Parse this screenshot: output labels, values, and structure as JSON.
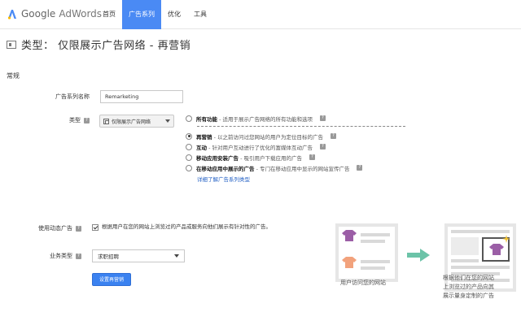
{
  "header": {
    "logo_google": "Google",
    "logo_adwords": "AdWords",
    "nav": [
      "首页",
      "广告系列",
      "优化",
      "工具"
    ],
    "active_nav": "广告系列"
  },
  "page": {
    "title": "类型： 仅限展示广告网络 - 再营销"
  },
  "section": {
    "general": "常规"
  },
  "form": {
    "name_label": "广告系列名称",
    "name_value": "Remarketing",
    "type_label": "类型",
    "type_value": "仅限展示广告网络",
    "dynamic_label": "使用动态广告",
    "dynamic_text": "根据用户在您的网站上浏览过的产品或服务向他们展示有针对性的广告。",
    "dynamic_checked": true,
    "biz_label": "业务类型",
    "biz_value": "求职招聘",
    "setup_button": "设置再营销",
    "help_glyph": "?"
  },
  "type_options": {
    "all_features": {
      "name": "所有功能",
      "desc": " - 适用于展示广告网络的所有功能和选项",
      "checked": false
    },
    "remarketing": {
      "name": "再营销",
      "desc": " - 以之前访问过您网站的用户为定位目标的广告",
      "checked": true
    },
    "engagement": {
      "name": "互动",
      "desc": " - 针对用户互动进行了优化的富媒体互动广告",
      "checked": false
    },
    "app_install": {
      "name": "移动应用安装广告",
      "desc": " - 吸引用户下载应用的广告",
      "checked": false
    },
    "in_app": {
      "name": "在移动应用中展示的广告",
      "desc": " - 专门在移动应用中显示的网站宣传广告",
      "checked": false
    },
    "learn_more": "详细了解广告系列类型"
  },
  "illustration": {
    "caption_left": "用户访问您的网站",
    "caption_right": [
      "根据他们在您的网站",
      "上浏览过的产品向其",
      "展示量身定制的广告"
    ],
    "colors": {
      "arrow": "#6cc3a8",
      "shirt_purple": "#9b5ea6",
      "shirt_orange": "#f2a27c",
      "card_border": "#e6e6e6"
    }
  },
  "colors": {
    "accent": "#4a8af4",
    "button": "#3b82f0",
    "link": "#2461c5"
  }
}
